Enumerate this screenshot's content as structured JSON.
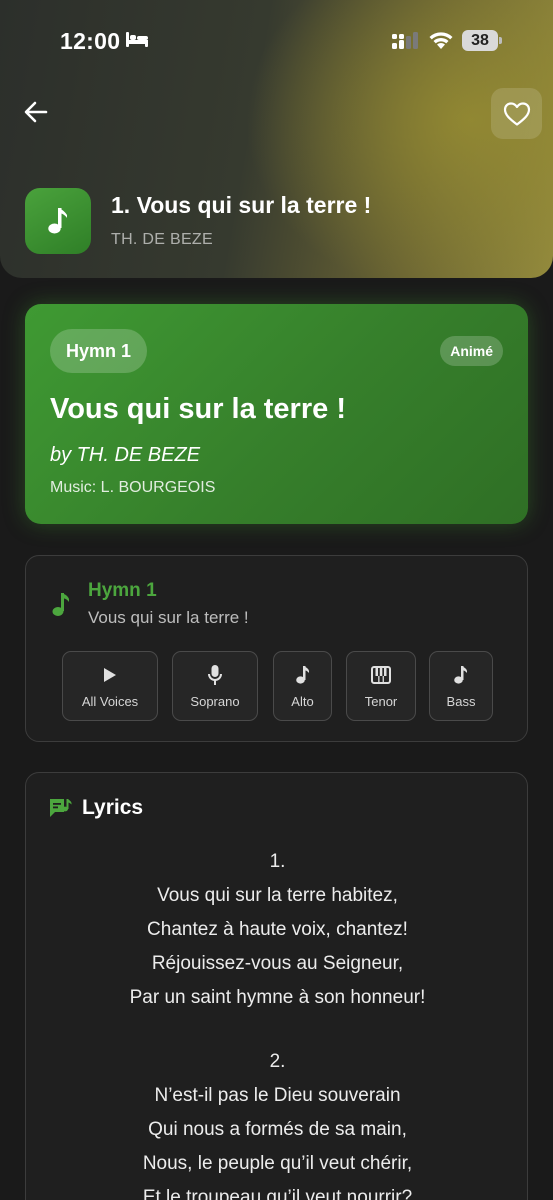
{
  "status_bar": {
    "time": "12:00",
    "battery": "38",
    "icons": [
      "bed-icon",
      "signal-icon",
      "wifi-icon",
      "battery-icon"
    ]
  },
  "header": {
    "back_icon": "back-arrow-icon",
    "favorite_icon": "heart-icon",
    "app_icon": "music-note-icon",
    "title": "1. Vous qui sur la terre !",
    "author": "TH. DE BEZE",
    "colors": {
      "gradient_start": "#2c2f2b",
      "gradient_end": "#938a3d"
    }
  },
  "hymn_card": {
    "number_label": "Hymn 1",
    "badge": "Animé",
    "title": "Vous qui sur la terre !",
    "author": "by TH. DE BEZE",
    "music": "Music: L. BOURGEOIS",
    "accent": "#3f9a33"
  },
  "player": {
    "hymn_label": "Hymn 1",
    "subtitle": "Vous qui sur la terre !",
    "note_icon": "music-note-icon",
    "voices": [
      {
        "label": "All Voices",
        "icon": "play-icon"
      },
      {
        "label": "Soprano",
        "icon": "microphone-icon"
      },
      {
        "label": "Alto",
        "icon": "music-note-icon"
      },
      {
        "label": "Tenor",
        "icon": "piano-icon"
      },
      {
        "label": "Bass",
        "icon": "music-note-icon"
      }
    ]
  },
  "lyrics": {
    "title": "Lyrics",
    "icon": "lyrics-icon",
    "stanzas": [
      {
        "number": "1.",
        "lines": [
          "Vous qui sur la terre habitez,",
          "Chantez à haute voix, chantez!",
          "Réjouissez-vous au Seigneur,",
          "Par un saint hymne à son honneur!"
        ]
      },
      {
        "number": "2.",
        "lines": [
          "N’est-il pas le Dieu souverain",
          "Qui nous a formés de sa main,",
          "Nous, le peuple qu’il veut chérir,",
          "Et le troupeau qu’il veut nourrir?"
        ]
      }
    ]
  }
}
